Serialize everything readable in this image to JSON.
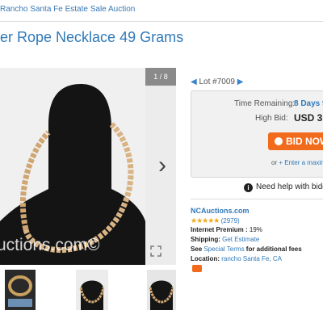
{
  "breadcrumb": "Rancho Santa Fe Estate Sale Auction",
  "title": "er Rope Necklace 49 Grams",
  "gallery": {
    "counter": "1 / 8",
    "watermark": "uctions.com©"
  },
  "lot": {
    "label": "Lot #7009"
  },
  "bid": {
    "time_label": "Time Remaining:",
    "time_value": "8 Days 9",
    "high_bid_label": "High Bid:",
    "high_bid_value": "USD 3.",
    "button_label": "BID NOW",
    "or_text": "or",
    "max_link": "Enter a maxim"
  },
  "help_text": "Need help with bidd",
  "seller": {
    "name": "NCAuctions.com",
    "stars": "★★★★★",
    "rating_count": "(2979)",
    "premium_label": "Internet Premium :",
    "premium_value": "19%",
    "shipping_label": "Shipping:",
    "shipping_link": "Get Estimate",
    "see_text": "See",
    "terms_link": "Special Terms",
    "terms_suffix": "for additional fees",
    "location_label": "Location:",
    "location_link": "rancho Santa Fe, CA"
  },
  "colors": {
    "link": "#2f79b8",
    "bid_button": "#f26a1b",
    "stars": "#f0a818"
  }
}
